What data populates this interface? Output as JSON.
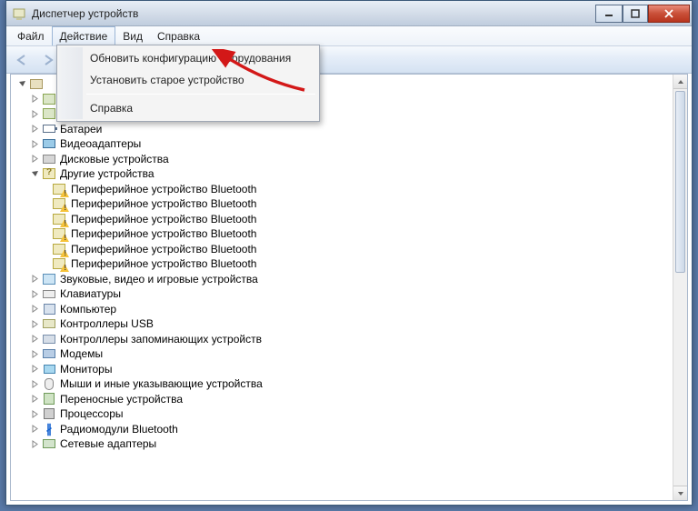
{
  "window": {
    "title": "Диспетчер устройств"
  },
  "menubar": {
    "file": "Файл",
    "action": "Действие",
    "view": "Вид",
    "help": "Справка"
  },
  "dropdown": {
    "scan": "Обновить конфигурацию оборудования",
    "legacy": "Установить старое устройство",
    "help": "Справка"
  },
  "tree": {
    "items": [
      {
        "label": "Батареи",
        "icon": "battery"
      },
      {
        "label": "Видеоадаптеры",
        "icon": "monitor"
      },
      {
        "label": "Дисковые устройства",
        "icon": "disk"
      }
    ],
    "other_label": "Другие устройства",
    "bt_periph": "Периферийное устройство Bluetooth",
    "rest": [
      {
        "label": "Звуковые, видео и игровые устройства",
        "icon": "sound"
      },
      {
        "label": "Клавиатуры",
        "icon": "kb"
      },
      {
        "label": "Компьютер",
        "icon": "pc"
      },
      {
        "label": "Контроллеры USB",
        "icon": "usb"
      },
      {
        "label": "Контроллеры запоминающих устройств",
        "icon": "storage"
      },
      {
        "label": "Модемы",
        "icon": "modem"
      },
      {
        "label": "Мониторы",
        "icon": "mon2"
      },
      {
        "label": "Мыши и иные указывающие устройства",
        "icon": "mouse"
      },
      {
        "label": "Переносные устройства",
        "icon": "portable"
      },
      {
        "label": "Процессоры",
        "icon": "cpu"
      },
      {
        "label": "Радиомодули Bluetooth",
        "icon": "bt"
      },
      {
        "label": "Сетевые адаптеры",
        "icon": "net"
      }
    ]
  }
}
